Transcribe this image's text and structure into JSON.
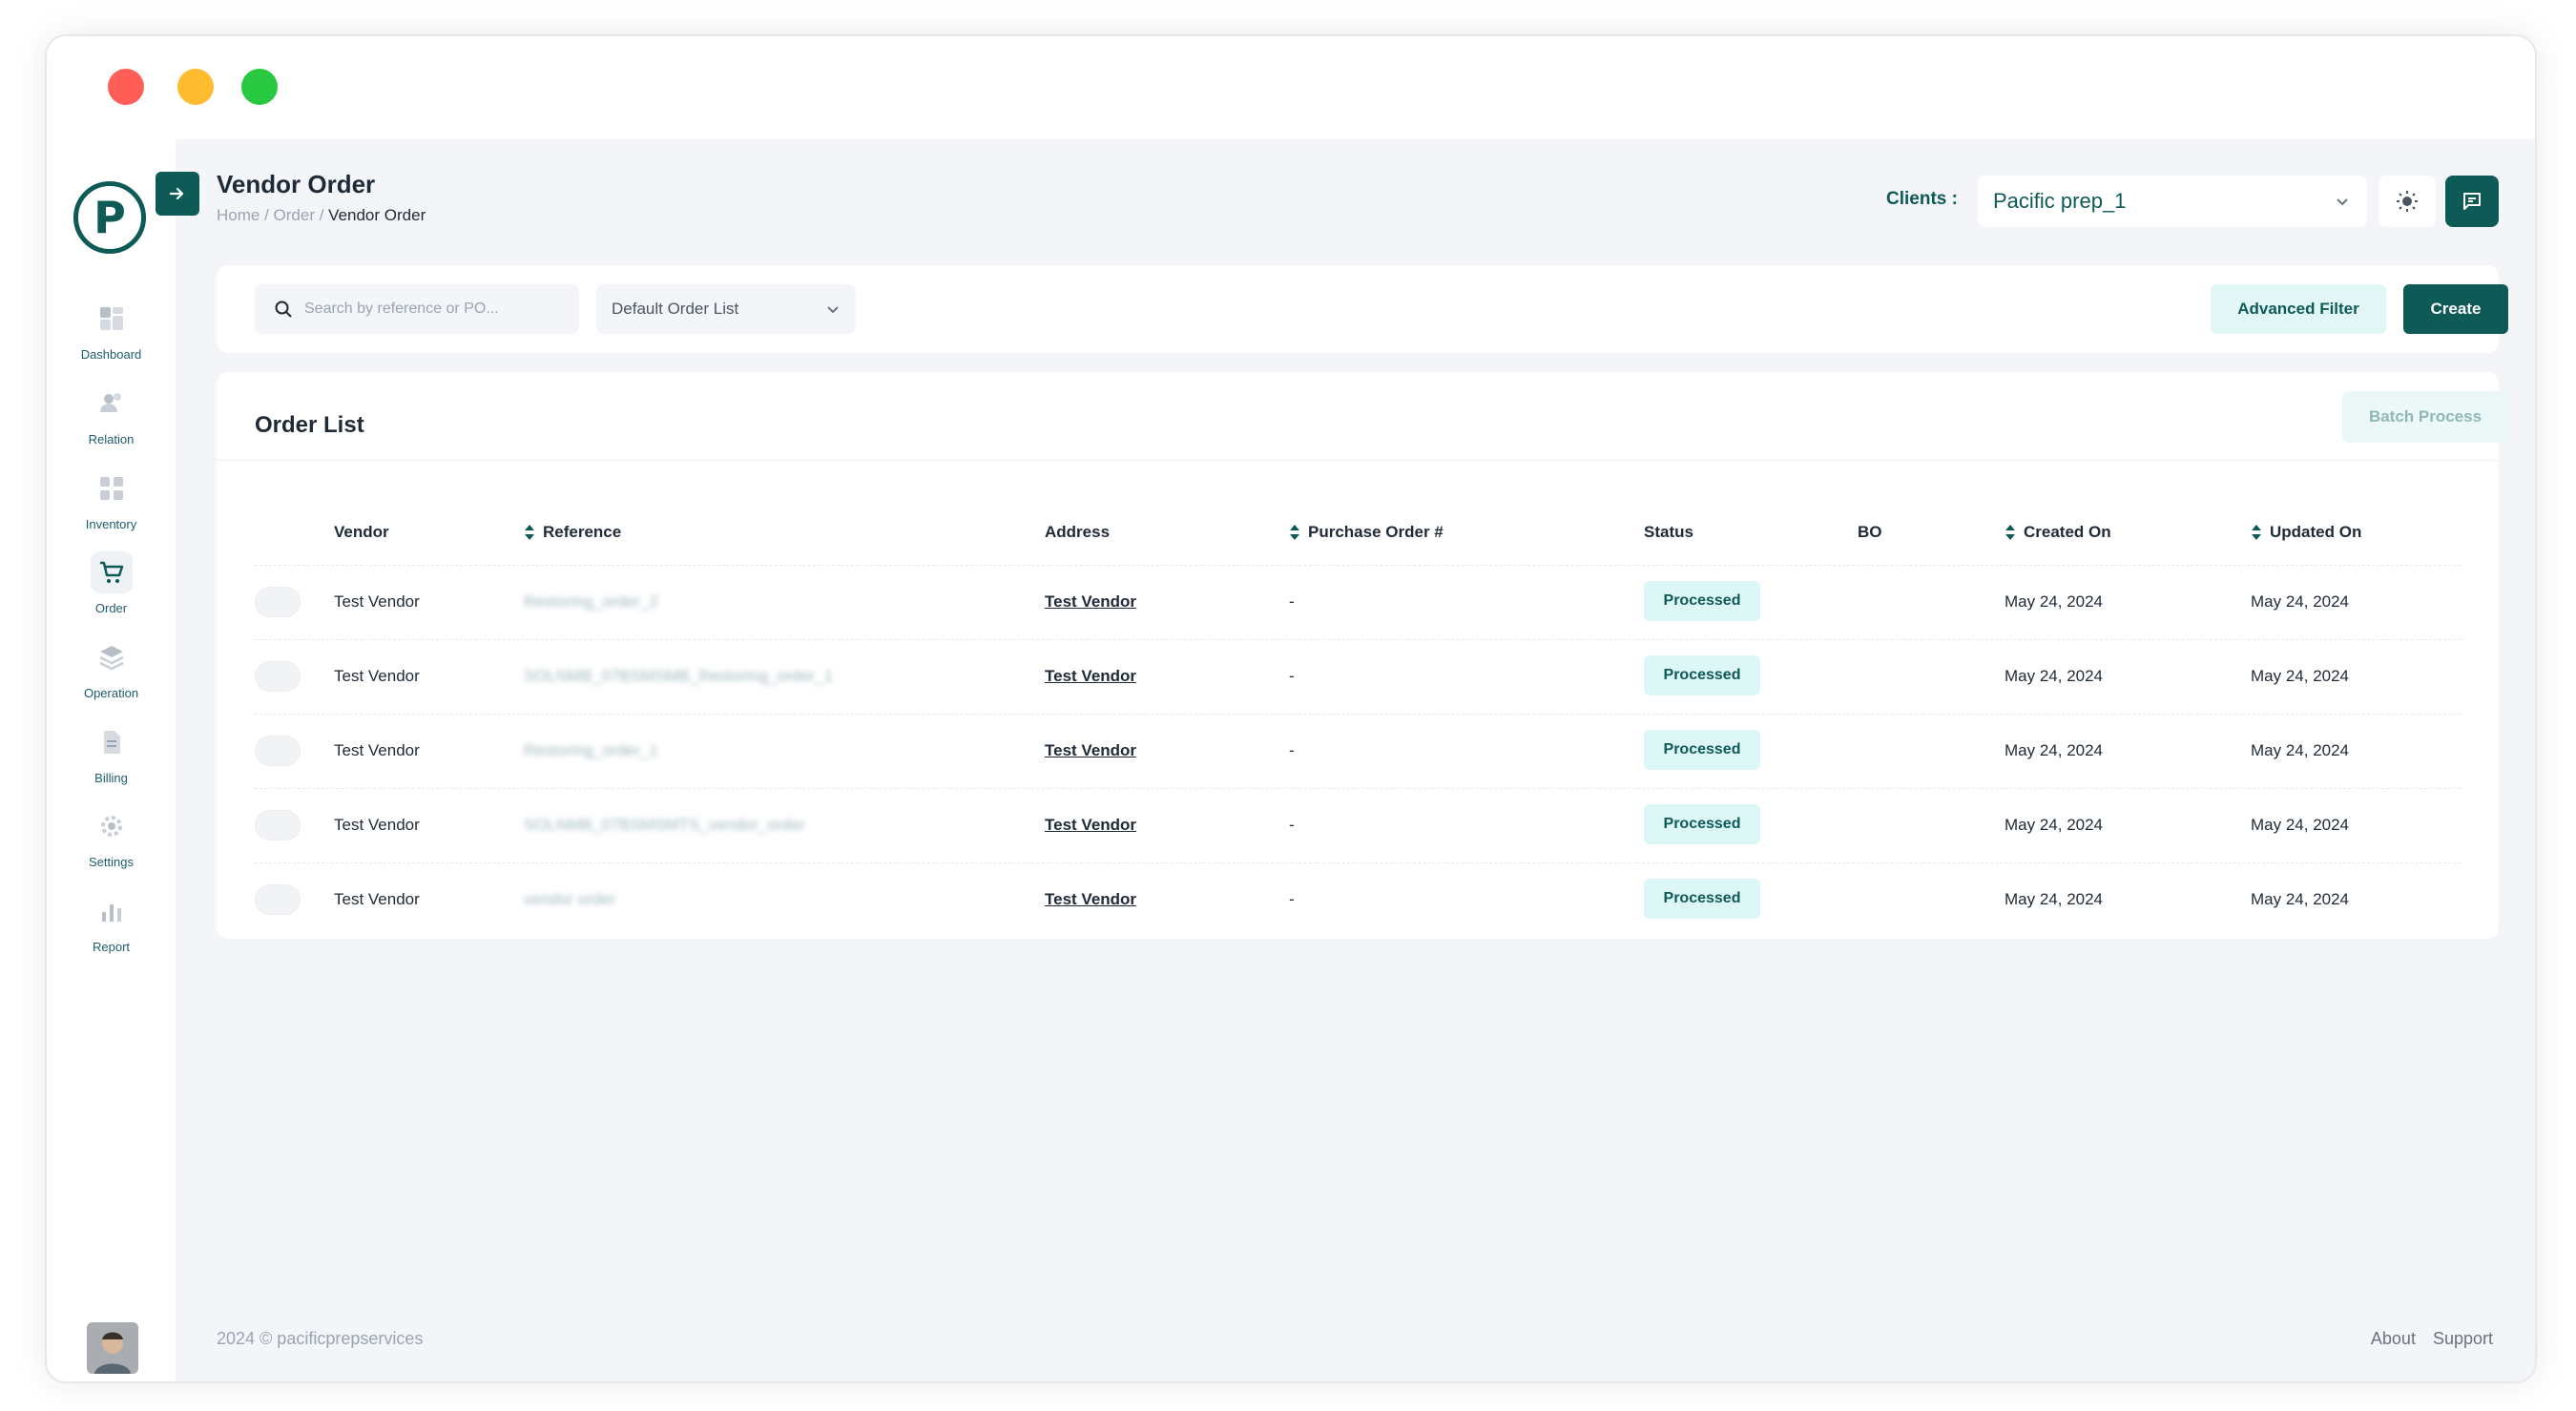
{
  "app": {
    "page_title": "Vendor Order",
    "breadcrumb": [
      "Home",
      "Order",
      "Vendor Order"
    ],
    "logo_letter": "P"
  },
  "sidebar": {
    "items": [
      {
        "label": "Dashboard",
        "icon": "dashboard-icon"
      },
      {
        "label": "Relation",
        "icon": "users-icon"
      },
      {
        "label": "Inventory",
        "icon": "inventory-icon"
      },
      {
        "label": "Order",
        "icon": "cart-icon",
        "active": true
      },
      {
        "label": "Operation",
        "icon": "layers-icon"
      },
      {
        "label": "Billing",
        "icon": "document-icon"
      },
      {
        "label": "Settings",
        "icon": "gear-icon"
      },
      {
        "label": "Report",
        "icon": "bar-chart-icon"
      }
    ]
  },
  "header": {
    "clients_label": "Clients :",
    "client_value": "Pacific prep_1"
  },
  "toolbar": {
    "search_placeholder": "Search by reference or PO...",
    "order_list_select": "Default Order List",
    "advanced_filter": "Advanced Filter",
    "create": "Create"
  },
  "order_list": {
    "title": "Order List",
    "batch_process": "Batch Process",
    "columns": [
      "Vendor",
      "Reference",
      "Address",
      "Purchase Order #",
      "Status",
      "BO",
      "Created On",
      "Updated On"
    ],
    "rows": [
      {
        "vendor": "Test Vendor",
        "reference": "Restoring_order_2",
        "address": "Test Vendor",
        "po": "-",
        "status": "Processed",
        "bo": "",
        "created": "May 24, 2024",
        "updated": "May 24, 2024"
      },
      {
        "vendor": "Test Vendor",
        "reference": "SOLNMB_07BSMSMB_Restoring_order_1",
        "address": "Test Vendor",
        "po": "-",
        "status": "Processed",
        "bo": "",
        "created": "May 24, 2024",
        "updated": "May 24, 2024"
      },
      {
        "vendor": "Test Vendor",
        "reference": "Restoring_order_1",
        "address": "Test Vendor",
        "po": "-",
        "status": "Processed",
        "bo": "",
        "created": "May 24, 2024",
        "updated": "May 24, 2024"
      },
      {
        "vendor": "Test Vendor",
        "reference": "SOLNMB_07BSMSMTS_vendor_order",
        "address": "Test Vendor",
        "po": "-",
        "status": "Processed",
        "bo": "",
        "created": "May 24, 2024",
        "updated": "May 24, 2024"
      },
      {
        "vendor": "Test Vendor",
        "reference": "vendor order",
        "address": "Test Vendor",
        "po": "-",
        "status": "Processed",
        "bo": "",
        "created": "May 24, 2024",
        "updated": "May 24, 2024"
      }
    ]
  },
  "footer": {
    "copyright": "2024 © pacificprepservices",
    "about": "About",
    "support": "Support"
  },
  "colors": {
    "brand": "#0e5a56",
    "badge_bg": "#ddf6f6",
    "background": "#f3f5f8"
  }
}
